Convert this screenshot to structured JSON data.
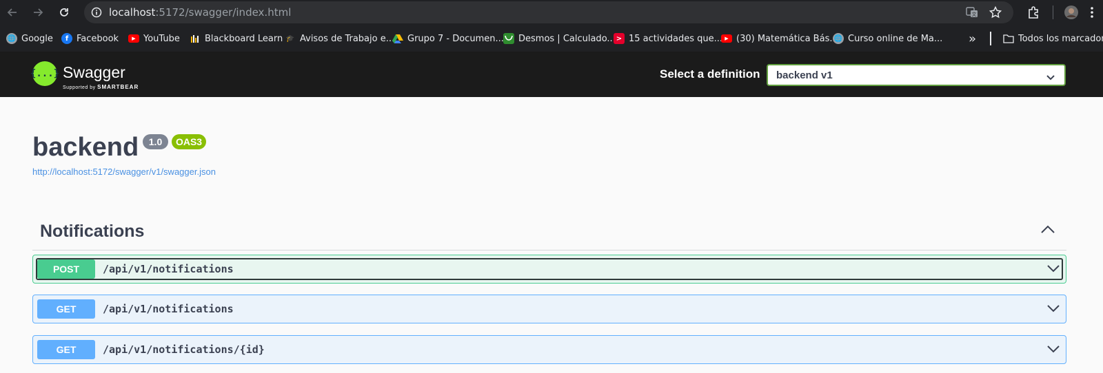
{
  "browser": {
    "url_host": "localhost",
    "url_path": ":5172/swagger/index.html",
    "bookmarks": [
      {
        "label": "Google",
        "icon": "globe-icon",
        "color": "#9aa0a6"
      },
      {
        "label": "Facebook",
        "icon": "facebook-icon",
        "color": "#1877f2"
      },
      {
        "label": "YouTube",
        "icon": "youtube-icon",
        "color": "#ff0000"
      },
      {
        "label": "Blackboard Learn",
        "icon": "blackboard-icon",
        "color": "#d4a017"
      },
      {
        "label": "Avisos de Trabajo e...",
        "icon": "hat-icon",
        "color": "#8a7a5a"
      },
      {
        "label": "Grupo 7 - Documen...",
        "icon": "drive-icon",
        "color": "#34a853"
      },
      {
        "label": "Desmos | Calculado...",
        "icon": "desmos-icon",
        "color": "#2f8d2f"
      },
      {
        "label": "15 actividades que...",
        "icon": "speakerdeck-icon",
        "color": "#e4002b"
      },
      {
        "label": "(30) Matemática Bás...",
        "icon": "youtube-icon",
        "color": "#ff0000"
      },
      {
        "label": "Curso online de Ma...",
        "icon": "globe-icon",
        "color": "#9aa0a6"
      }
    ],
    "more_label": "»",
    "all_bookmarks_label": "Todos los marcadores"
  },
  "swagger": {
    "logo_text": "Swagger",
    "logo_mark": "{...}",
    "supported_by": "Supported by",
    "smartbear": "SMARTBEAR",
    "definition_label": "Select a definition",
    "definition_value": "backend v1"
  },
  "info": {
    "title": "backend",
    "version": "1.0",
    "oas": "OAS3",
    "spec_url": "http://localhost:5172/swagger/v1/swagger.json"
  },
  "tag": {
    "name": "Notifications",
    "operations": [
      {
        "method": "POST",
        "path": "/api/v1/notifications"
      },
      {
        "method": "GET",
        "path": "/api/v1/notifications"
      },
      {
        "method": "GET",
        "path": "/api/v1/notifications/{id}"
      }
    ]
  }
}
